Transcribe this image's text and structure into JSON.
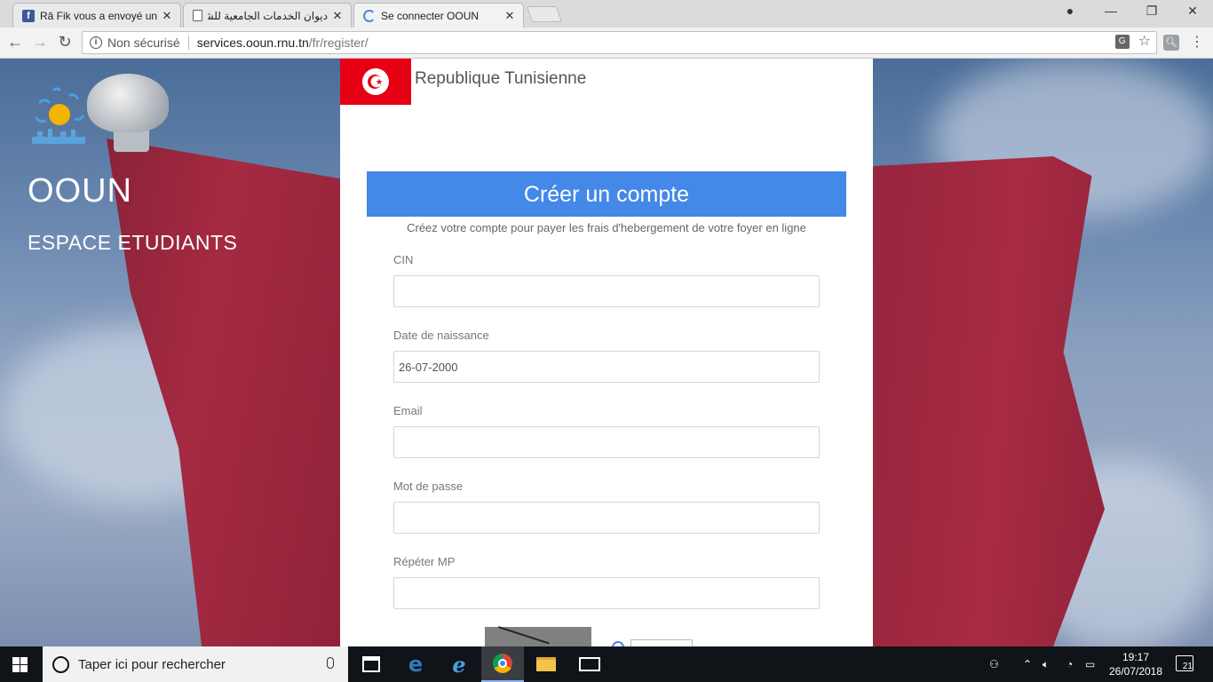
{
  "browser": {
    "tabs": [
      {
        "title": "Rā Fik vous a envoyé un m",
        "active": false,
        "favicon": "facebook-icon"
      },
      {
        "title": "ديوان الخدمات الجامعية للشمال",
        "active": false,
        "favicon": "document-icon"
      },
      {
        "title": "Se connecter OOUN",
        "active": true,
        "favicon": "loading-icon"
      }
    ],
    "security_label": "Non sécurisé",
    "url_host": "services.ooun.rnu.tn",
    "url_path": "/fr/register/"
  },
  "page": {
    "brand_title": "OOUN",
    "brand_subtitle": "ESPACE ETUDIANTS",
    "republic": "Republique Tunisienne",
    "form_title": "Créer un compte",
    "form_subtitle": "Créez votre compte pour payer les frais d'hebergement de votre foyer en ligne",
    "fields": [
      {
        "label": "CIN",
        "value": "",
        "placeholder": ""
      },
      {
        "label": "Date de naissance",
        "value": "26-07-2000",
        "placeholder": ""
      },
      {
        "label": "Email",
        "value": "",
        "placeholder": ""
      },
      {
        "label": "Mot de passe",
        "value": "",
        "placeholder": ""
      },
      {
        "label": "Répéter MP",
        "value": "",
        "placeholder": ""
      }
    ]
  },
  "taskbar": {
    "search_placeholder": "Taper ici pour rechercher",
    "time": "19:17",
    "date": "26/07/2018",
    "notification_count": "21"
  },
  "colors": {
    "accent": "#4488e8",
    "flag_red": "#e70013"
  }
}
